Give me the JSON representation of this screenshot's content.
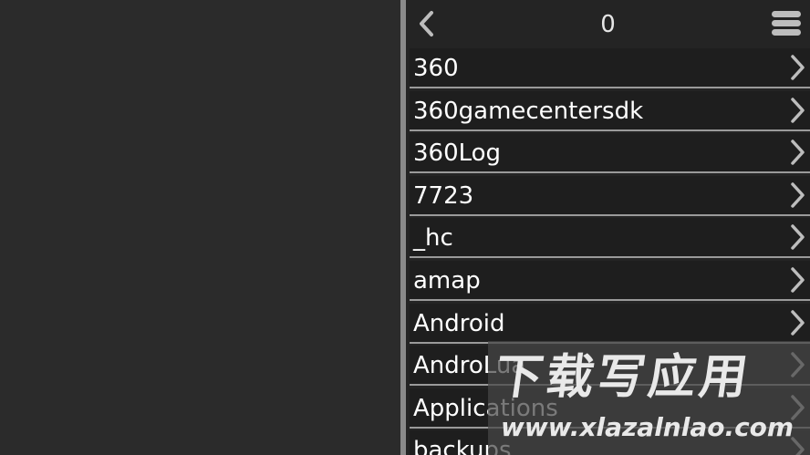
{
  "header": {
    "title": "0",
    "back_icon": "chevron-left-icon",
    "menu_icon": "menu-icon"
  },
  "folders": [
    {
      "label": "360"
    },
    {
      "label": "360gamecentersdk"
    },
    {
      "label": "360Log"
    },
    {
      "label": "7723"
    },
    {
      "label": "_hc"
    },
    {
      "label": "amap"
    },
    {
      "label": "Android"
    },
    {
      "label": "AndroLua"
    },
    {
      "label": "Applications"
    },
    {
      "label": "backups"
    }
  ],
  "watermark": {
    "chinese": "下载写应用",
    "url": "www.xlazalnlao.com"
  },
  "colors": {
    "background": "#2b2b2b",
    "divider": "#8a8a8a",
    "row_bg": "#1e1e1e",
    "text": "#ffffff"
  }
}
